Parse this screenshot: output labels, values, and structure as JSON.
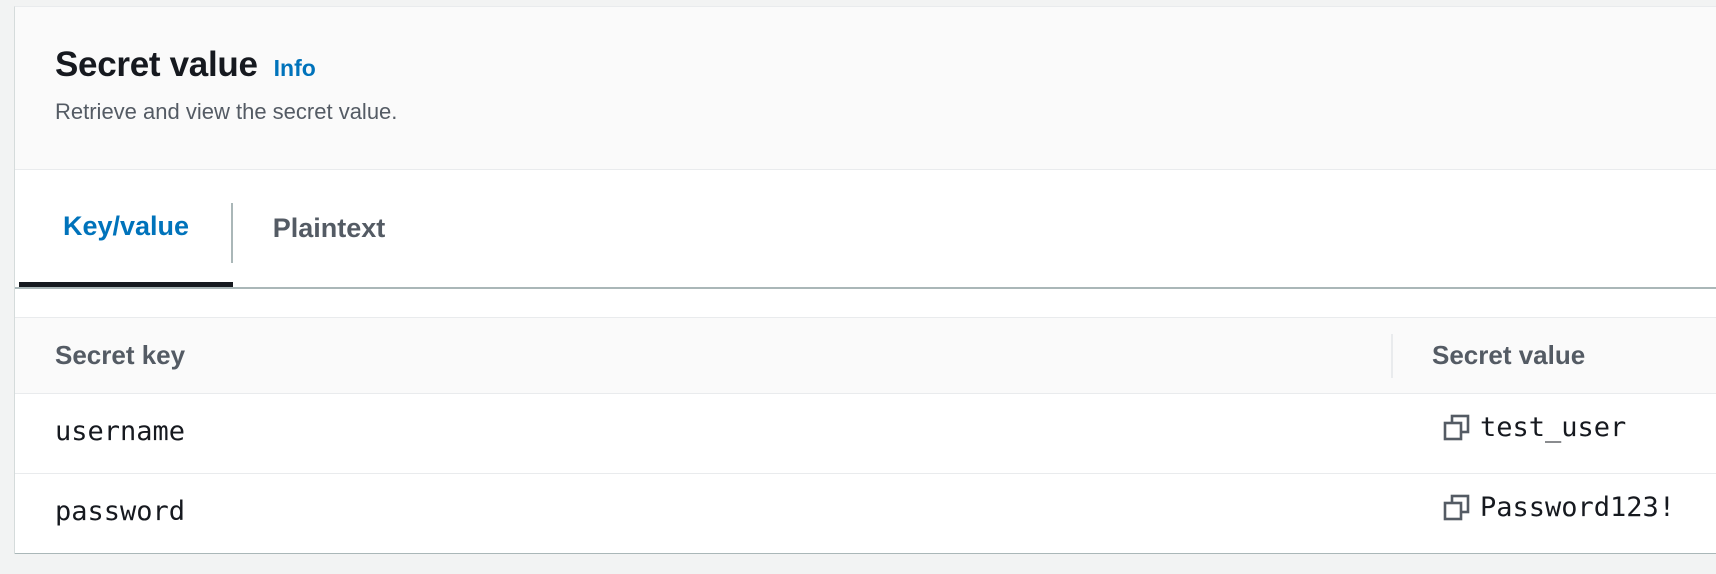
{
  "header": {
    "title": "Secret value",
    "info_label": "Info",
    "description": "Retrieve and view the secret value."
  },
  "tabs": [
    {
      "label": "Key/value",
      "selected": true
    },
    {
      "label": "Plaintext",
      "selected": false
    }
  ],
  "table": {
    "columns": [
      "Secret key",
      "Secret value"
    ],
    "rows": [
      {
        "key": "username",
        "value": "test_user"
      },
      {
        "key": "password",
        "value": "Password123!"
      }
    ]
  },
  "icons": {
    "copy": "copy-icon"
  },
  "colors": {
    "link": "#0073bb",
    "text": "#16191f",
    "muted": "#545b64",
    "header_bg": "#fafafa"
  }
}
